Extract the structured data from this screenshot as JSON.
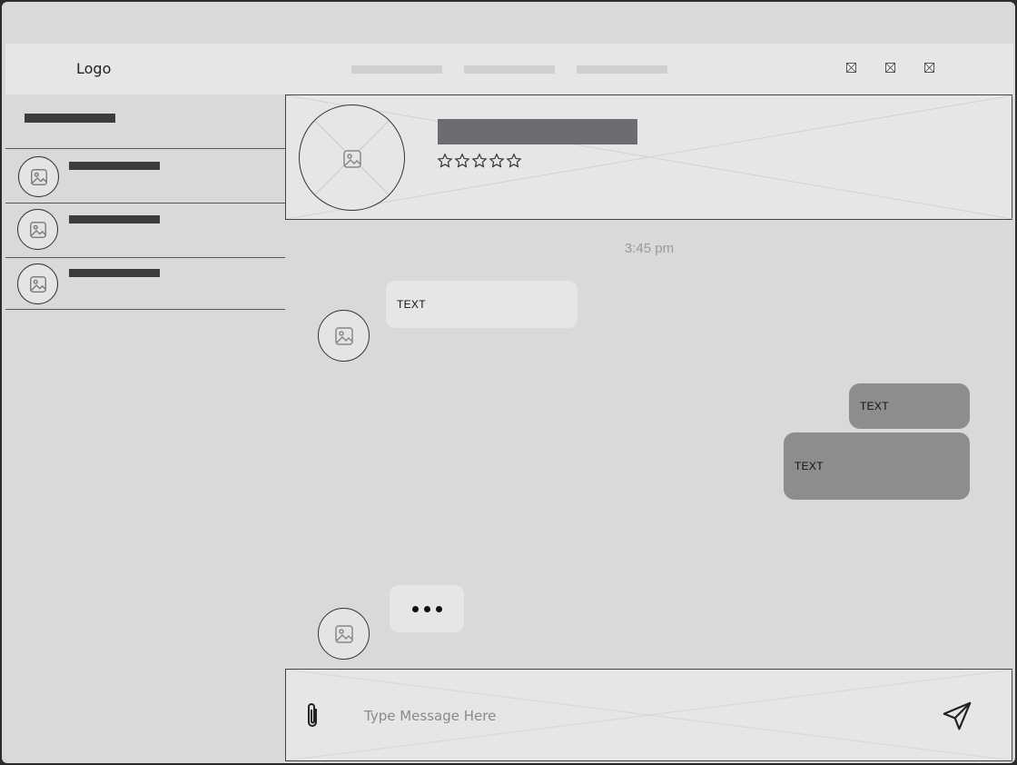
{
  "topbar": {
    "logo": "Logo",
    "nav_items": [
      "",
      "",
      ""
    ],
    "window_icons": [
      "minimize-icon",
      "maximize-icon",
      "close-icon"
    ]
  },
  "sidebar": {
    "title": "",
    "contacts": [
      {
        "name": "",
        "avatar_icon": "image-placeholder-icon"
      },
      {
        "name": "",
        "avatar_icon": "image-placeholder-icon"
      },
      {
        "name": "",
        "avatar_icon": "image-placeholder-icon"
      }
    ]
  },
  "chat_header": {
    "name": "",
    "rating": 0,
    "rating_max": 5
  },
  "messages": {
    "timestamp": "3:45 pm",
    "incoming_1": "TEXT",
    "outgoing_1": "TEXT",
    "outgoing_2": "TEXT",
    "typing_indicator": "..."
  },
  "composer": {
    "placeholder": "Type Message Here",
    "value": "",
    "attach_icon": "paperclip-icon",
    "send_icon": "send-icon"
  },
  "colors": {
    "background": "#d9d9d9",
    "panel": "#e6e6e6",
    "outgoing_bubble": "#8d8d8d",
    "header_bar": "#6e6c70"
  }
}
